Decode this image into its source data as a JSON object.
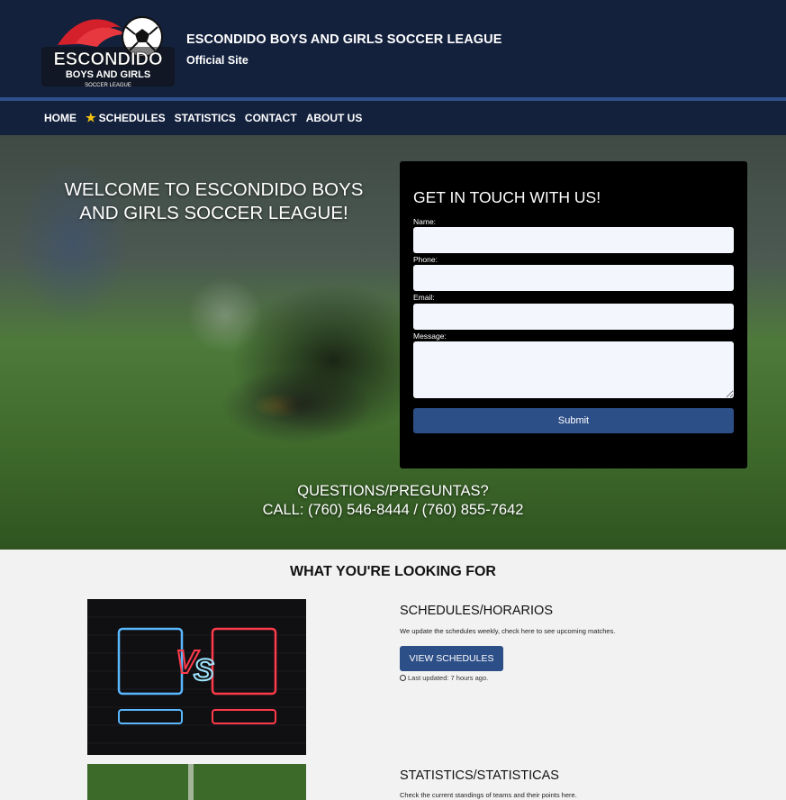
{
  "header": {
    "logo_text_main": "ESCONDIDO",
    "logo_text_sub": "BOYS AND GIRLS",
    "logo_text_small": "SOCCER LEAGUE",
    "title": "ESCONDIDO BOYS AND GIRLS SOCCER LEAGUE",
    "subtitle": "Official Site"
  },
  "nav": {
    "items": [
      {
        "label": "HOME"
      },
      {
        "label": "SCHEDULES",
        "icon": "star-icon"
      },
      {
        "label": "STATISTICS"
      },
      {
        "label": "CONTACT"
      },
      {
        "label": "ABOUT US"
      }
    ]
  },
  "hero": {
    "title": "WELCOME TO ESCONDIDO BOYS AND GIRLS SOCCER LEAGUE!",
    "questions_line1": "QUESTIONS/PREGUNTAS?",
    "questions_line2": "CALL: (760) 546-8444 / (760) 855-7642"
  },
  "contact_form": {
    "title": "GET IN TOUCH WITH US!",
    "name_label": "Name:",
    "name_value": "",
    "phone_label": "Phone:",
    "phone_value": "",
    "email_label": "Email:",
    "email_value": "",
    "message_label": "Message:",
    "message_value": "",
    "submit_label": "Submit"
  },
  "section": {
    "title": "WHAT YOU'RE LOOKING FOR",
    "cards": [
      {
        "title": "SCHEDULES/HORARIOS",
        "description": "We update the schedules weekly, check here to see upcoming matches.",
        "button_label": "VIEW SCHEDULES",
        "last_updated": "Last updated: 7 hours ago.",
        "image_text": "VS"
      },
      {
        "title": "STATISTICS/STATISTICAS",
        "description": "Check the current standings of teams and their points here."
      }
    ]
  },
  "colors": {
    "header_bg": "#13213d",
    "accent_blue": "#2d4f88",
    "star": "#f4c20d"
  }
}
